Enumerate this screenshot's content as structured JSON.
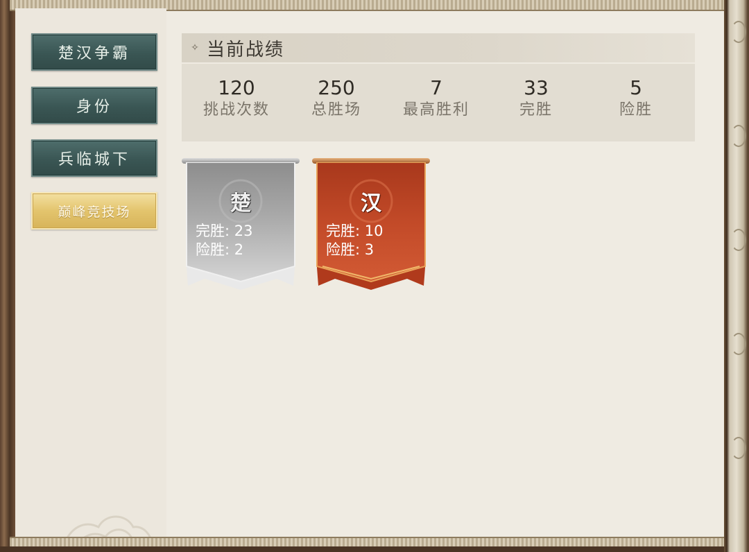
{
  "sidebar": {
    "items": [
      {
        "label": "楚汉争霸",
        "active": false
      },
      {
        "label": "身份",
        "active": false
      },
      {
        "label": "兵临城下",
        "active": false
      },
      {
        "label": "巅峰竞技场",
        "active": true
      }
    ]
  },
  "section": {
    "title": "当前战绩"
  },
  "stats": [
    {
      "value": "120",
      "label": "挑战次数"
    },
    {
      "value": "250",
      "label": "总胜场"
    },
    {
      "value": "7",
      "label": "最高胜利"
    },
    {
      "value": "33",
      "label": "完胜"
    },
    {
      "value": "5",
      "label": "险胜"
    }
  ],
  "banners": [
    {
      "name": "楚",
      "line1": "完胜: 23",
      "line2": "险胜: 2",
      "color": "#b7b7b7"
    },
    {
      "name": "汉",
      "line1": "完胜: 10",
      "line2": "险胜: 3",
      "color": "#c24a28"
    }
  ]
}
